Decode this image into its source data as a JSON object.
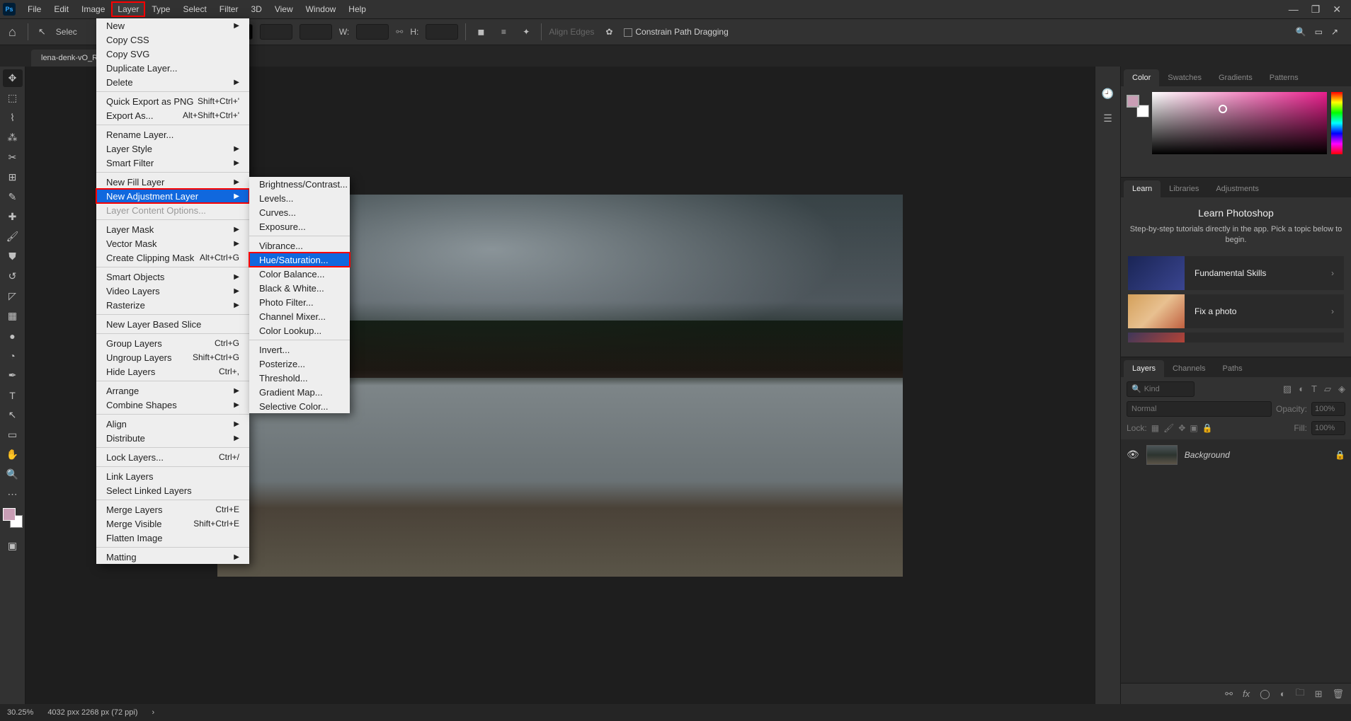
{
  "menubar": [
    "File",
    "Edit",
    "Image",
    "Layer",
    "Type",
    "Select",
    "Filter",
    "3D",
    "View",
    "Window",
    "Help"
  ],
  "open_menu_index": 3,
  "options_bar": {
    "select_label": "Selec",
    "w_label": "W:",
    "h_label": "H:",
    "align_edges": "Align Edges",
    "constrain": "Constrain Path Dragging"
  },
  "doc_tab": "lena-denk-vO_Rg",
  "layer_menu": [
    {
      "label": "New",
      "arrow": true
    },
    {
      "label": "Copy CSS"
    },
    {
      "label": "Copy SVG"
    },
    {
      "label": "Duplicate Layer..."
    },
    {
      "label": "Delete",
      "arrow": true
    },
    {
      "sep": true
    },
    {
      "label": "Quick Export as PNG",
      "shortcut": "Shift+Ctrl+'"
    },
    {
      "label": "Export As...",
      "shortcut": "Alt+Shift+Ctrl+'"
    },
    {
      "sep": true
    },
    {
      "label": "Rename Layer..."
    },
    {
      "label": "Layer Style",
      "arrow": true
    },
    {
      "label": "Smart Filter",
      "arrow": true
    },
    {
      "sep": true
    },
    {
      "label": "New Fill Layer",
      "arrow": true
    },
    {
      "label": "New Adjustment Layer",
      "arrow": true,
      "hl": true,
      "boxed": true
    },
    {
      "label": "Layer Content Options...",
      "disabled": true
    },
    {
      "sep": true
    },
    {
      "label": "Layer Mask",
      "arrow": true
    },
    {
      "label": "Vector Mask",
      "arrow": true
    },
    {
      "label": "Create Clipping Mask",
      "shortcut": "Alt+Ctrl+G"
    },
    {
      "sep": true
    },
    {
      "label": "Smart Objects",
      "arrow": true
    },
    {
      "label": "Video Layers",
      "arrow": true
    },
    {
      "label": "Rasterize",
      "arrow": true
    },
    {
      "sep": true
    },
    {
      "label": "New Layer Based Slice"
    },
    {
      "sep": true
    },
    {
      "label": "Group Layers",
      "shortcut": "Ctrl+G"
    },
    {
      "label": "Ungroup Layers",
      "shortcut": "Shift+Ctrl+G"
    },
    {
      "label": "Hide Layers",
      "shortcut": "Ctrl+,"
    },
    {
      "sep": true
    },
    {
      "label": "Arrange",
      "arrow": true
    },
    {
      "label": "Combine Shapes",
      "arrow": true
    },
    {
      "sep": true
    },
    {
      "label": "Align",
      "arrow": true
    },
    {
      "label": "Distribute",
      "arrow": true
    },
    {
      "sep": true
    },
    {
      "label": "Lock Layers...",
      "shortcut": "Ctrl+/"
    },
    {
      "sep": true
    },
    {
      "label": "Link Layers"
    },
    {
      "label": "Select Linked Layers"
    },
    {
      "sep": true
    },
    {
      "label": "Merge Layers",
      "shortcut": "Ctrl+E"
    },
    {
      "label": "Merge Visible",
      "shortcut": "Shift+Ctrl+E"
    },
    {
      "label": "Flatten Image"
    },
    {
      "sep": true
    },
    {
      "label": "Matting",
      "arrow": true
    }
  ],
  "adjust_menu": [
    {
      "label": "Brightness/Contrast..."
    },
    {
      "label": "Levels..."
    },
    {
      "label": "Curves..."
    },
    {
      "label": "Exposure..."
    },
    {
      "sep": true
    },
    {
      "label": "Vibrance..."
    },
    {
      "label": "Hue/Saturation...",
      "hl": true,
      "boxed": true
    },
    {
      "label": "Color Balance..."
    },
    {
      "label": "Black & White..."
    },
    {
      "label": "Photo Filter..."
    },
    {
      "label": "Channel Mixer..."
    },
    {
      "label": "Color Lookup..."
    },
    {
      "sep": true
    },
    {
      "label": "Invert..."
    },
    {
      "label": "Posterize..."
    },
    {
      "label": "Threshold..."
    },
    {
      "label": "Gradient Map..."
    },
    {
      "label": "Selective Color..."
    }
  ],
  "color_tabs": [
    "Color",
    "Swatches",
    "Gradients",
    "Patterns"
  ],
  "learn_tabs": [
    "Learn",
    "Libraries",
    "Adjustments"
  ],
  "learn": {
    "title": "Learn Photoshop",
    "sub": "Step-by-step tutorials directly in the app. Pick a topic below to begin.",
    "items": [
      "Fundamental Skills",
      "Fix a photo"
    ]
  },
  "layers_tabs": [
    "Layers",
    "Channels",
    "Paths"
  ],
  "layers": {
    "kind": "Kind",
    "blend": "Normal",
    "opacity_label": "Opacity:",
    "opacity": "100%",
    "lock_label": "Lock:",
    "fill_label": "Fill:",
    "fill": "100%",
    "bg_name": "Background"
  },
  "status": {
    "zoom": "30.25%",
    "dims": "4032 pxx 2268 px (72 ppi)"
  }
}
